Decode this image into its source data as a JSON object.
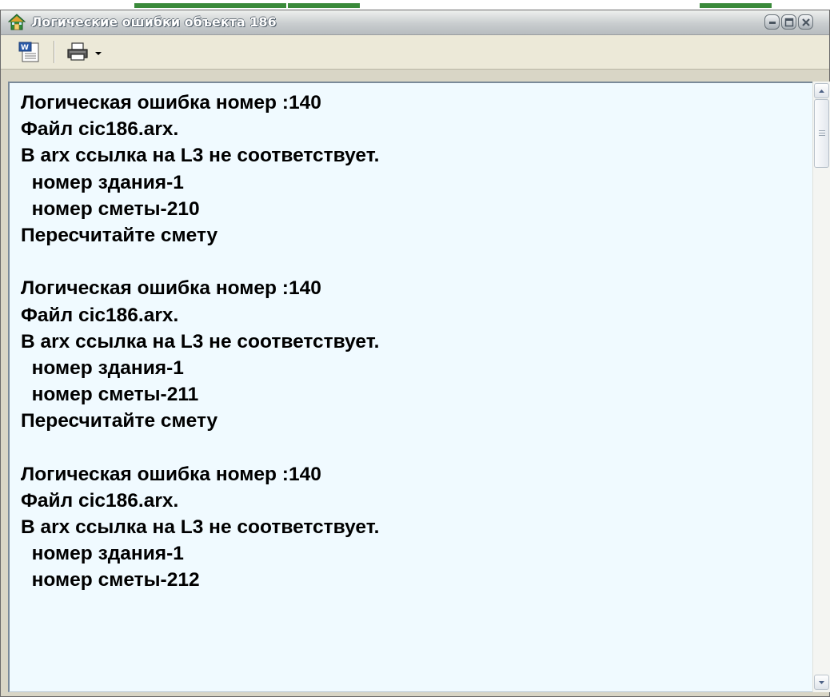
{
  "window": {
    "title": "Логические ошибки объекта 186",
    "controls": {
      "minimize_icon": "minimize-icon",
      "maximize_icon": "maximize-icon",
      "close_icon": "close-icon"
    }
  },
  "toolbar": {
    "tools": [
      {
        "name": "word-export",
        "icon": "word-document-icon"
      },
      {
        "name": "print",
        "icon": "printer-icon",
        "has_dropdown": true
      }
    ]
  },
  "report": {
    "lines": [
      "Логическая ошибка номер :140",
      "Файл cic186.arx.",
      "В arx ссылка на L3 не соответствует.",
      "  номер здания-1",
      "  номер сметы-210",
      "Пересчитайте смету",
      "",
      "Логическая ошибка номер :140",
      "Файл cic186.arx.",
      "В arx ссылка на L3 не соответствует.",
      "  номер здания-1",
      "  номер сметы-211",
      "Пересчитайте смету",
      "",
      "Логическая ошибка номер :140",
      "Файл cic186.arx.",
      "В arx ссылка на L3 не соответствует.",
      "  номер здания-1",
      "  номер сметы-212"
    ]
  },
  "colors": {
    "content_background": "#f0faff",
    "titlebar_text": "#ffffff",
    "window_frame": "#6b6b6b"
  }
}
